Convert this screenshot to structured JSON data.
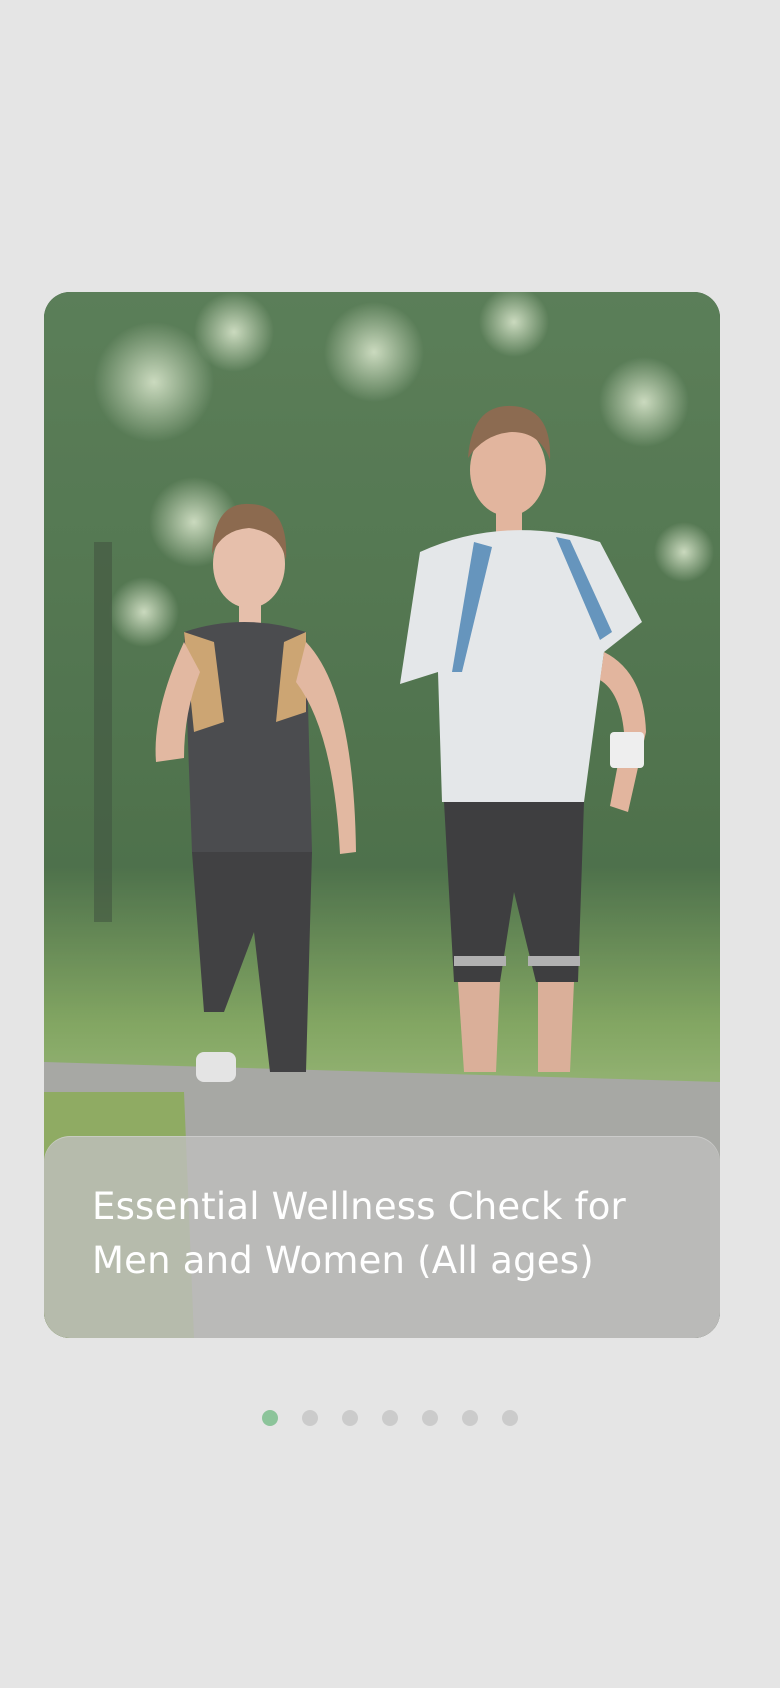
{
  "slide": {
    "title_line_1": "Essential Wellness Check for",
    "title_line_2": "Men and Women (All ages)",
    "image_description_icon": "photo-two-joggers"
  },
  "pagination": {
    "count": 7,
    "active_index": 0,
    "active_color": "#8cc49a",
    "inactive_color": "#cbcbcb"
  }
}
